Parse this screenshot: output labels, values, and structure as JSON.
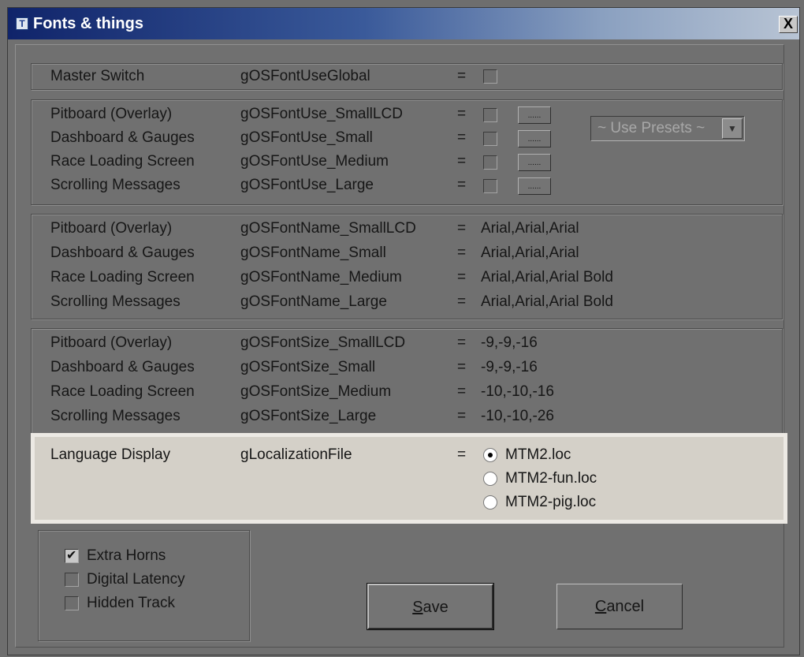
{
  "window": {
    "title": "Fonts & things",
    "close_label": "X"
  },
  "master": {
    "label": "Master Switch",
    "key": "gOSFontUseGlobal",
    "eq": "=",
    "checked": false
  },
  "font_use": {
    "rows": [
      {
        "label": "Pitboard (Overlay)",
        "key": "gOSFontUse_SmallLCD",
        "eq": "="
      },
      {
        "label": "Dashboard & Gauges",
        "key": "gOSFontUse_Small",
        "eq": "="
      },
      {
        "label": "Race Loading Screen",
        "key": "gOSFontUse_Medium",
        "eq": "="
      },
      {
        "label": "Scrolling Messages",
        "key": "gOSFontUse_Large",
        "eq": "="
      }
    ],
    "button_label": "......",
    "preset_value": "~ Use Presets ~",
    "preset_arrow": "▼"
  },
  "font_name": {
    "rows": [
      {
        "label": "Pitboard (Overlay)",
        "key": "gOSFontName_SmallLCD",
        "eq": "=",
        "value": "Arial,Arial,Arial"
      },
      {
        "label": "Dashboard & Gauges",
        "key": "gOSFontName_Small",
        "eq": "=",
        "value": "Arial,Arial,Arial"
      },
      {
        "label": "Race Loading Screen",
        "key": "gOSFontName_Medium",
        "eq": "=",
        "value": "Arial,Arial,Arial Bold"
      },
      {
        "label": "Scrolling Messages",
        "key": "gOSFontName_Large",
        "eq": "=",
        "value": "Arial,Arial,Arial Bold"
      }
    ]
  },
  "font_size": {
    "rows": [
      {
        "label": "Pitboard (Overlay)",
        "key": "gOSFontSize_SmallLCD",
        "eq": "=",
        "value": "-9,-9,-16"
      },
      {
        "label": "Dashboard & Gauges",
        "key": "gOSFontSize_Small",
        "eq": "=",
        "value": "-9,-9,-16"
      },
      {
        "label": "Race Loading Screen",
        "key": "gOSFontSize_Medium",
        "eq": "=",
        "value": "-10,-10,-16"
      },
      {
        "label": "Scrolling Messages",
        "key": "gOSFontSize_Large",
        "eq": "=",
        "value": "-10,-10,-26"
      }
    ]
  },
  "language": {
    "label": "Language Display",
    "key": "gLocalizationFile",
    "eq": "=",
    "options": [
      "MTM2.loc",
      "MTM2-fun.loc",
      "MTM2-pig.loc"
    ],
    "selected": "MTM2.loc"
  },
  "extras": [
    {
      "label": "Extra Horns",
      "checked": true
    },
    {
      "label": "Digital Latency",
      "checked": false
    },
    {
      "label": "Hidden Track",
      "checked": false
    }
  ],
  "buttons": {
    "save_accel": "S",
    "save_rest": "ave",
    "cancel_accel": "C",
    "cancel_rest": "ancel"
  }
}
